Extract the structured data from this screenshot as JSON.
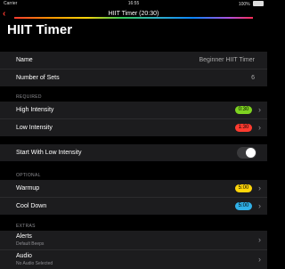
{
  "status_bar": {
    "carrier": "Carrier",
    "time": "16:55",
    "battery": "100%"
  },
  "nav": {
    "title": "HIIT Timer (20:30)",
    "back_glyph": "‹"
  },
  "page_title": "HIIT Timer",
  "info": {
    "name_label": "Name",
    "name_value": "Beginner HIIT Timer",
    "sets_label": "Number of Sets",
    "sets_value": "6"
  },
  "required": {
    "header": "REQUIRED",
    "high_label": "High Intensity",
    "high_value": "0:30",
    "high_color": "#7ed321",
    "low_label": "Low Intensity",
    "low_value": "1:30",
    "low_color": "#ff3b30"
  },
  "start_low": {
    "label": "Start With Low Intensity",
    "enabled": false
  },
  "optional": {
    "header": "OPTIONAL",
    "warmup_label": "Warmup",
    "warmup_value": "5:00",
    "warmup_color": "#ffd60a",
    "cooldown_label": "Cool Down",
    "cooldown_value": "5:00",
    "cooldown_color": "#30b0e7"
  },
  "extras": {
    "header": "EXTRAS",
    "alerts_label": "Alerts",
    "alerts_sub": "Default Beeps",
    "audio_label": "Audio",
    "audio_sub": "No Audio Selected"
  },
  "icons": {
    "chevron": "›"
  }
}
